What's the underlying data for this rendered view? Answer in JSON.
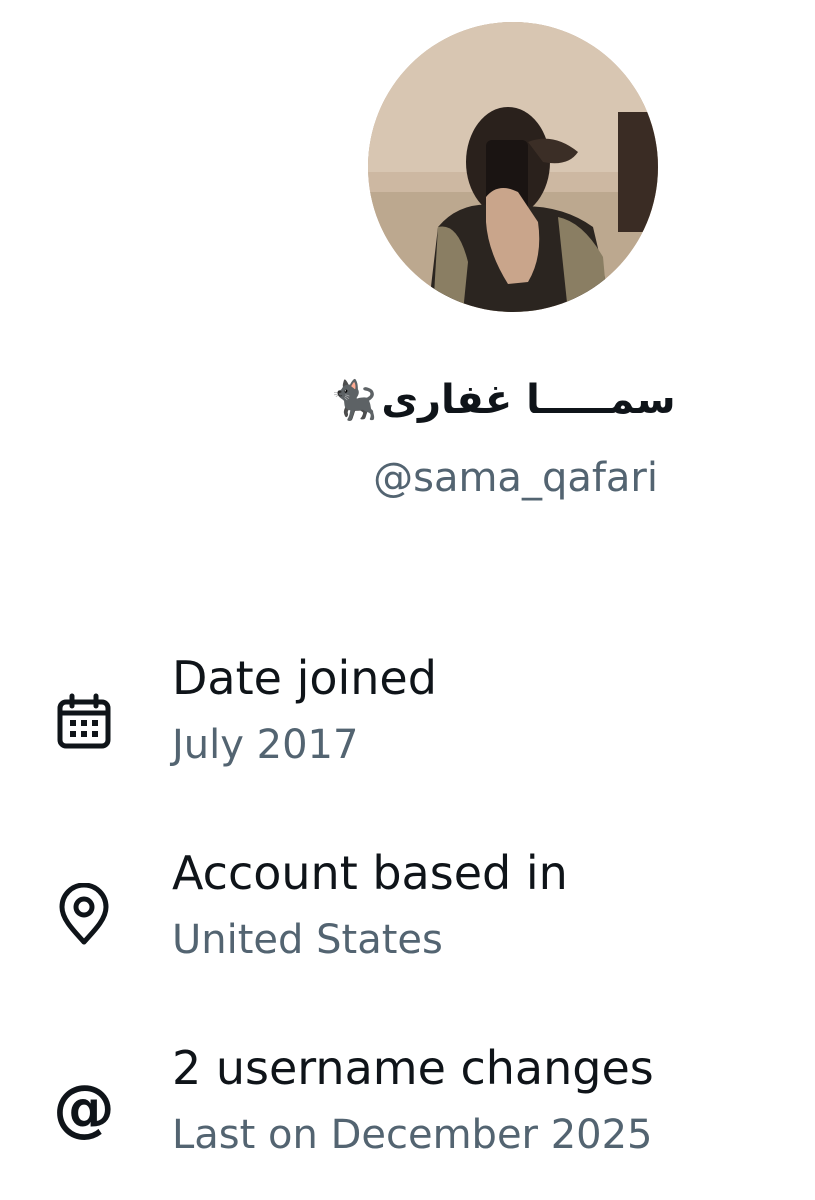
{
  "profile": {
    "display_name": "سمـــــا غفاری",
    "name_emoji": "🐈‍⬛",
    "handle": "@sama_qafari"
  },
  "about": {
    "items": [
      {
        "icon": "calendar-icon",
        "title": "Date joined",
        "subtitle": "July 2017"
      },
      {
        "icon": "location-pin-icon",
        "title": "Account based in",
        "subtitle": "United States"
      },
      {
        "icon": "at-sign-icon",
        "title": "2 username changes",
        "subtitle": "Last on December 2025"
      }
    ]
  },
  "colors": {
    "primary_text": "#0f1419",
    "secondary_text": "#536471",
    "background": "#ffffff"
  }
}
